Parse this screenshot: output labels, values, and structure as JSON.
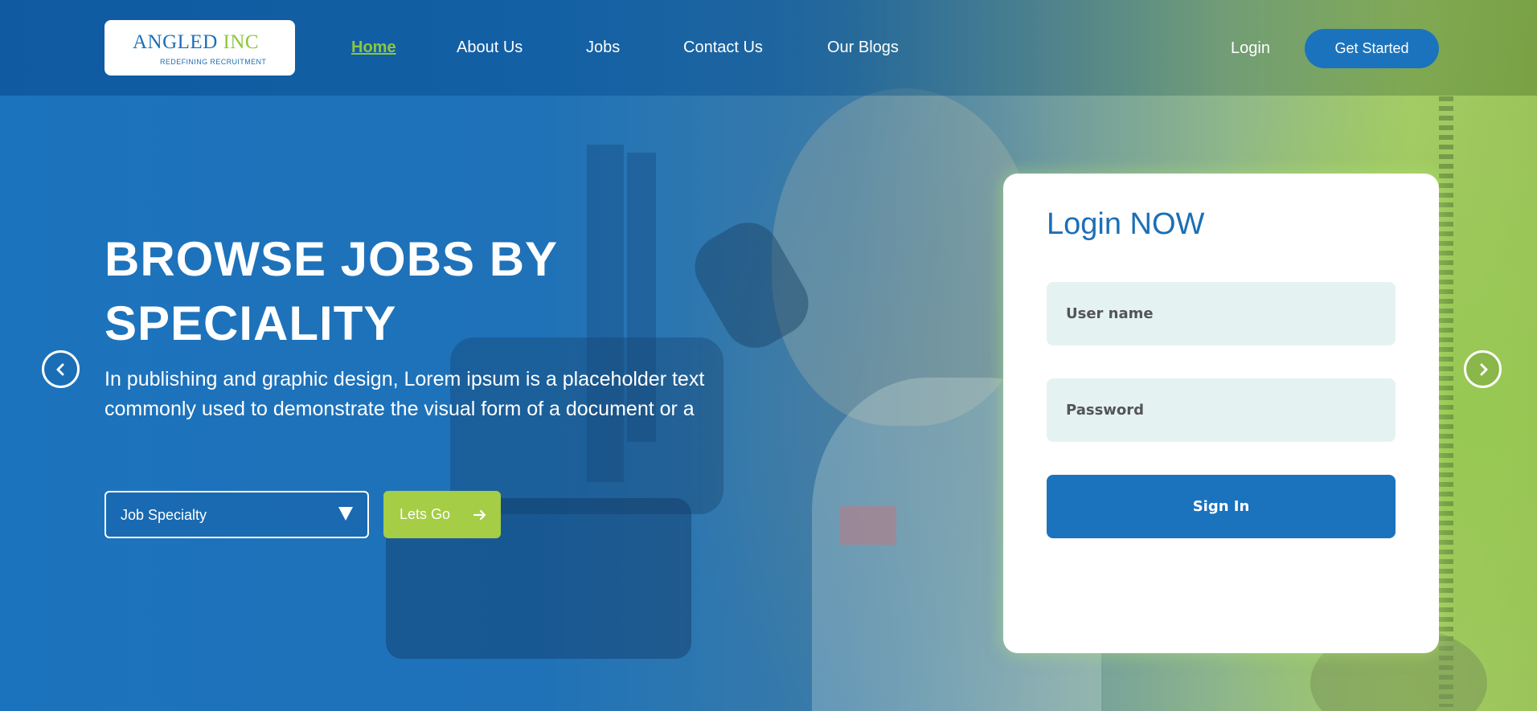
{
  "brand": {
    "name_part1": "ANGLED",
    "name_part2": "INC",
    "tagline": "REDEFINING RECRUITMENT"
  },
  "nav": {
    "items": [
      {
        "label": "Home",
        "active": true
      },
      {
        "label": "About Us",
        "active": false
      },
      {
        "label": "Jobs",
        "active": false
      },
      {
        "label": "Contact Us",
        "active": false
      },
      {
        "label": "Our Blogs",
        "active": false
      }
    ],
    "login_label": "Login",
    "cta_label": "Get Started"
  },
  "hero": {
    "title_line1": "BROWSE JOBS BY",
    "title_line2": "SPECIALITY",
    "description_line1": "In publishing and graphic design, Lorem ipsum is a placeholder text",
    "description_line2": "commonly used to demonstrate the visual form of a document or a",
    "select_value": "Job Specialty",
    "go_button_label": "Lets Go",
    "prev_icon": "chevron-left-icon",
    "next_icon": "chevron-right-icon"
  },
  "login_card": {
    "title": "Login NOW",
    "username_placeholder": "User name",
    "password_placeholder": "Password",
    "submit_label": "Sign In"
  },
  "colors": {
    "primary_blue": "#1b73bd",
    "accent_green": "#a5cd45",
    "field_bg": "#e4f3f2"
  }
}
